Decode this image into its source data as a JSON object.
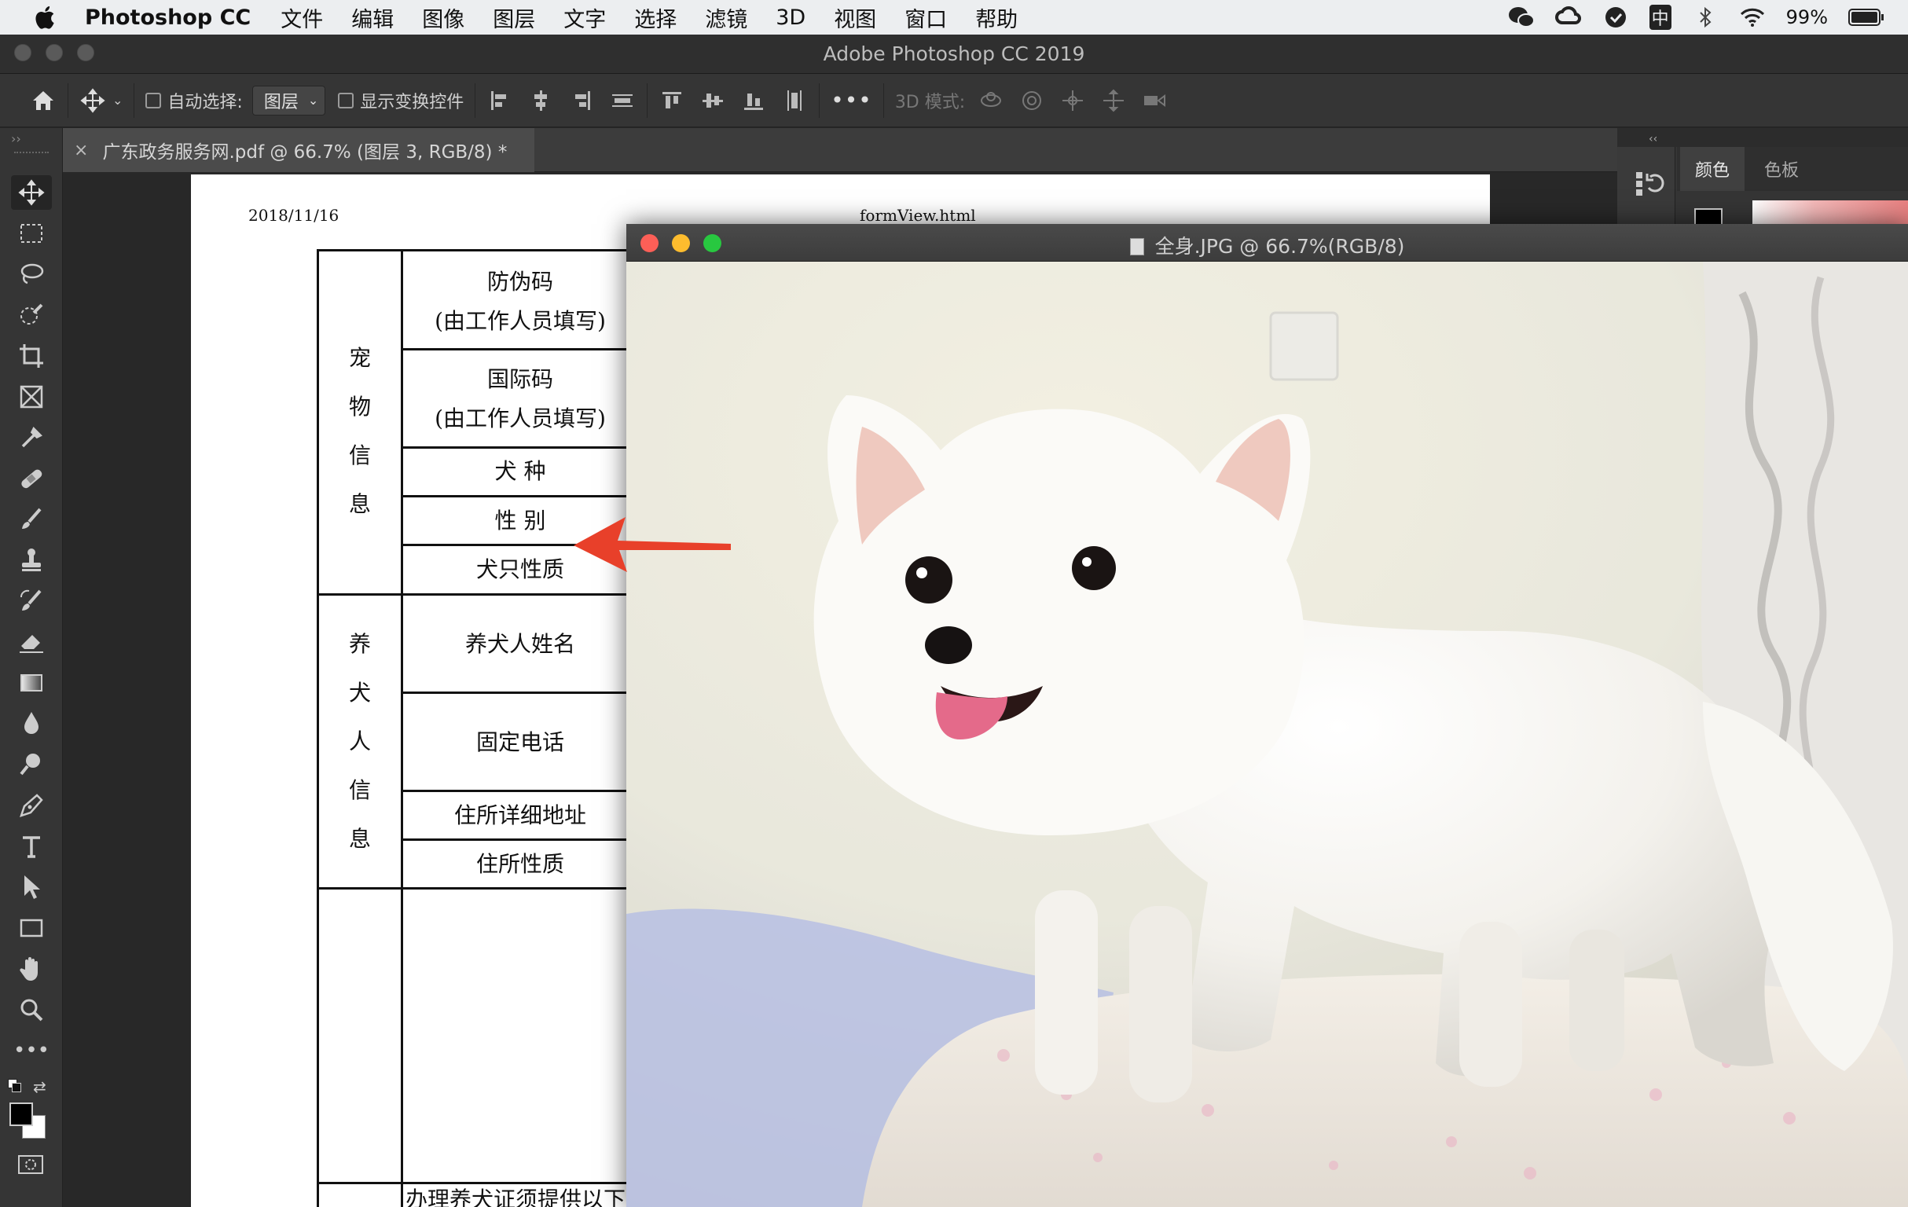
{
  "menubar": {
    "app_name": "Photoshop CC",
    "items": [
      "文件",
      "编辑",
      "图像",
      "图层",
      "文字",
      "选择",
      "滤镜",
      "3D",
      "视图",
      "窗口",
      "帮助"
    ],
    "battery": "99%",
    "status_icons": [
      "wechat-icon",
      "creative-cloud-icon",
      "vpn-icon",
      "input-method-icon",
      "bluetooth-icon",
      "wifi-icon",
      "battery-icon"
    ],
    "input_method": "中"
  },
  "window": {
    "title": "Adobe Photoshop CC 2019"
  },
  "options": {
    "auto_select_label": "自动选择:",
    "auto_select_value": "图层",
    "show_transform_label": "显示变换控件",
    "mode_3d_label": "3D 模式:"
  },
  "document_tab": {
    "label": "广东政务服务网.pdf @ 66.7% (图层 3, RGB/8) *"
  },
  "pdf": {
    "date": "2018/11/16",
    "url": "formView.html",
    "section_pet": [
      "宠",
      "物",
      "信",
      "息"
    ],
    "section_owner": [
      "养",
      "犬",
      "人",
      "信",
      "息"
    ],
    "rows": {
      "anti_fake_1": "防伪码",
      "anti_fake_2": "(由工作人员填写)",
      "intl_code_1": "国际码",
      "intl_code_2": "(由工作人员填写)",
      "breed": "犬 种",
      "sex": "性 别",
      "dog_nature": "犬只性质",
      "owner_name": "养犬人姓名",
      "landline": "固定电话",
      "address": "住所详细地址",
      "residence_type": "住所性质",
      "bottom_partial": "办理养犬证须提供以下"
    }
  },
  "image_window": {
    "title": "全身.JPG @ 66.7%(RGB/8)"
  },
  "right_panel": {
    "tab_color": "颜色",
    "tab_swatches": "色板"
  },
  "colors": {
    "arrow": "#e8402a",
    "close": "#fc5f57",
    "minimize": "#fdbc2e",
    "zoom": "#28c840"
  }
}
